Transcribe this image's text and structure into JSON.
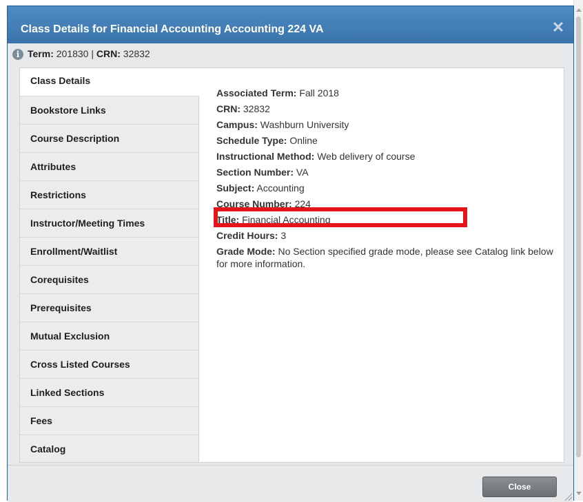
{
  "dialog": {
    "title": "Class Details for Financial Accounting Accounting 224 VA",
    "close_icon": "close-x-icon"
  },
  "term_bar": {
    "info_icon": "info-icon",
    "term_label": "Term:",
    "term_value": "201830",
    "separator": "|",
    "crn_label": "CRN:",
    "crn_value": "32832"
  },
  "tabs": [
    {
      "label": "Class Details",
      "active": true
    },
    {
      "label": "Bookstore Links"
    },
    {
      "label": "Course Description"
    },
    {
      "label": "Attributes"
    },
    {
      "label": "Restrictions"
    },
    {
      "label": "Instructor/Meeting Times"
    },
    {
      "label": "Enrollment/Waitlist"
    },
    {
      "label": "Corequisites"
    },
    {
      "label": "Prerequisites"
    },
    {
      "label": "Mutual Exclusion"
    },
    {
      "label": "Cross Listed Courses"
    },
    {
      "label": "Linked Sections"
    },
    {
      "label": "Fees"
    },
    {
      "label": "Catalog"
    }
  ],
  "details": [
    {
      "label": "Associated Term:",
      "value": "Fall 2018"
    },
    {
      "label": "CRN:",
      "value": "32832"
    },
    {
      "label": "Campus:",
      "value": "Washburn University"
    },
    {
      "label": "Schedule Type:",
      "value": "Online"
    },
    {
      "label": "Instructional Method:",
      "value": "Web delivery of course"
    },
    {
      "label": "Section Number:",
      "value": "VA"
    },
    {
      "label": "Subject:",
      "value": "Accounting"
    },
    {
      "label": "Course Number:",
      "value": "224"
    },
    {
      "label": "Title:",
      "value": "Financial Accounting"
    },
    {
      "label": "Credit Hours:",
      "value": "3"
    },
    {
      "label": "Grade Mode:",
      "value": "No Section specified grade mode, please see Catalog link below for more information."
    }
  ],
  "footer": {
    "close_label": "Close"
  },
  "colors": {
    "titlebar": "#3a74ab",
    "highlight_box": "#e5161b"
  }
}
